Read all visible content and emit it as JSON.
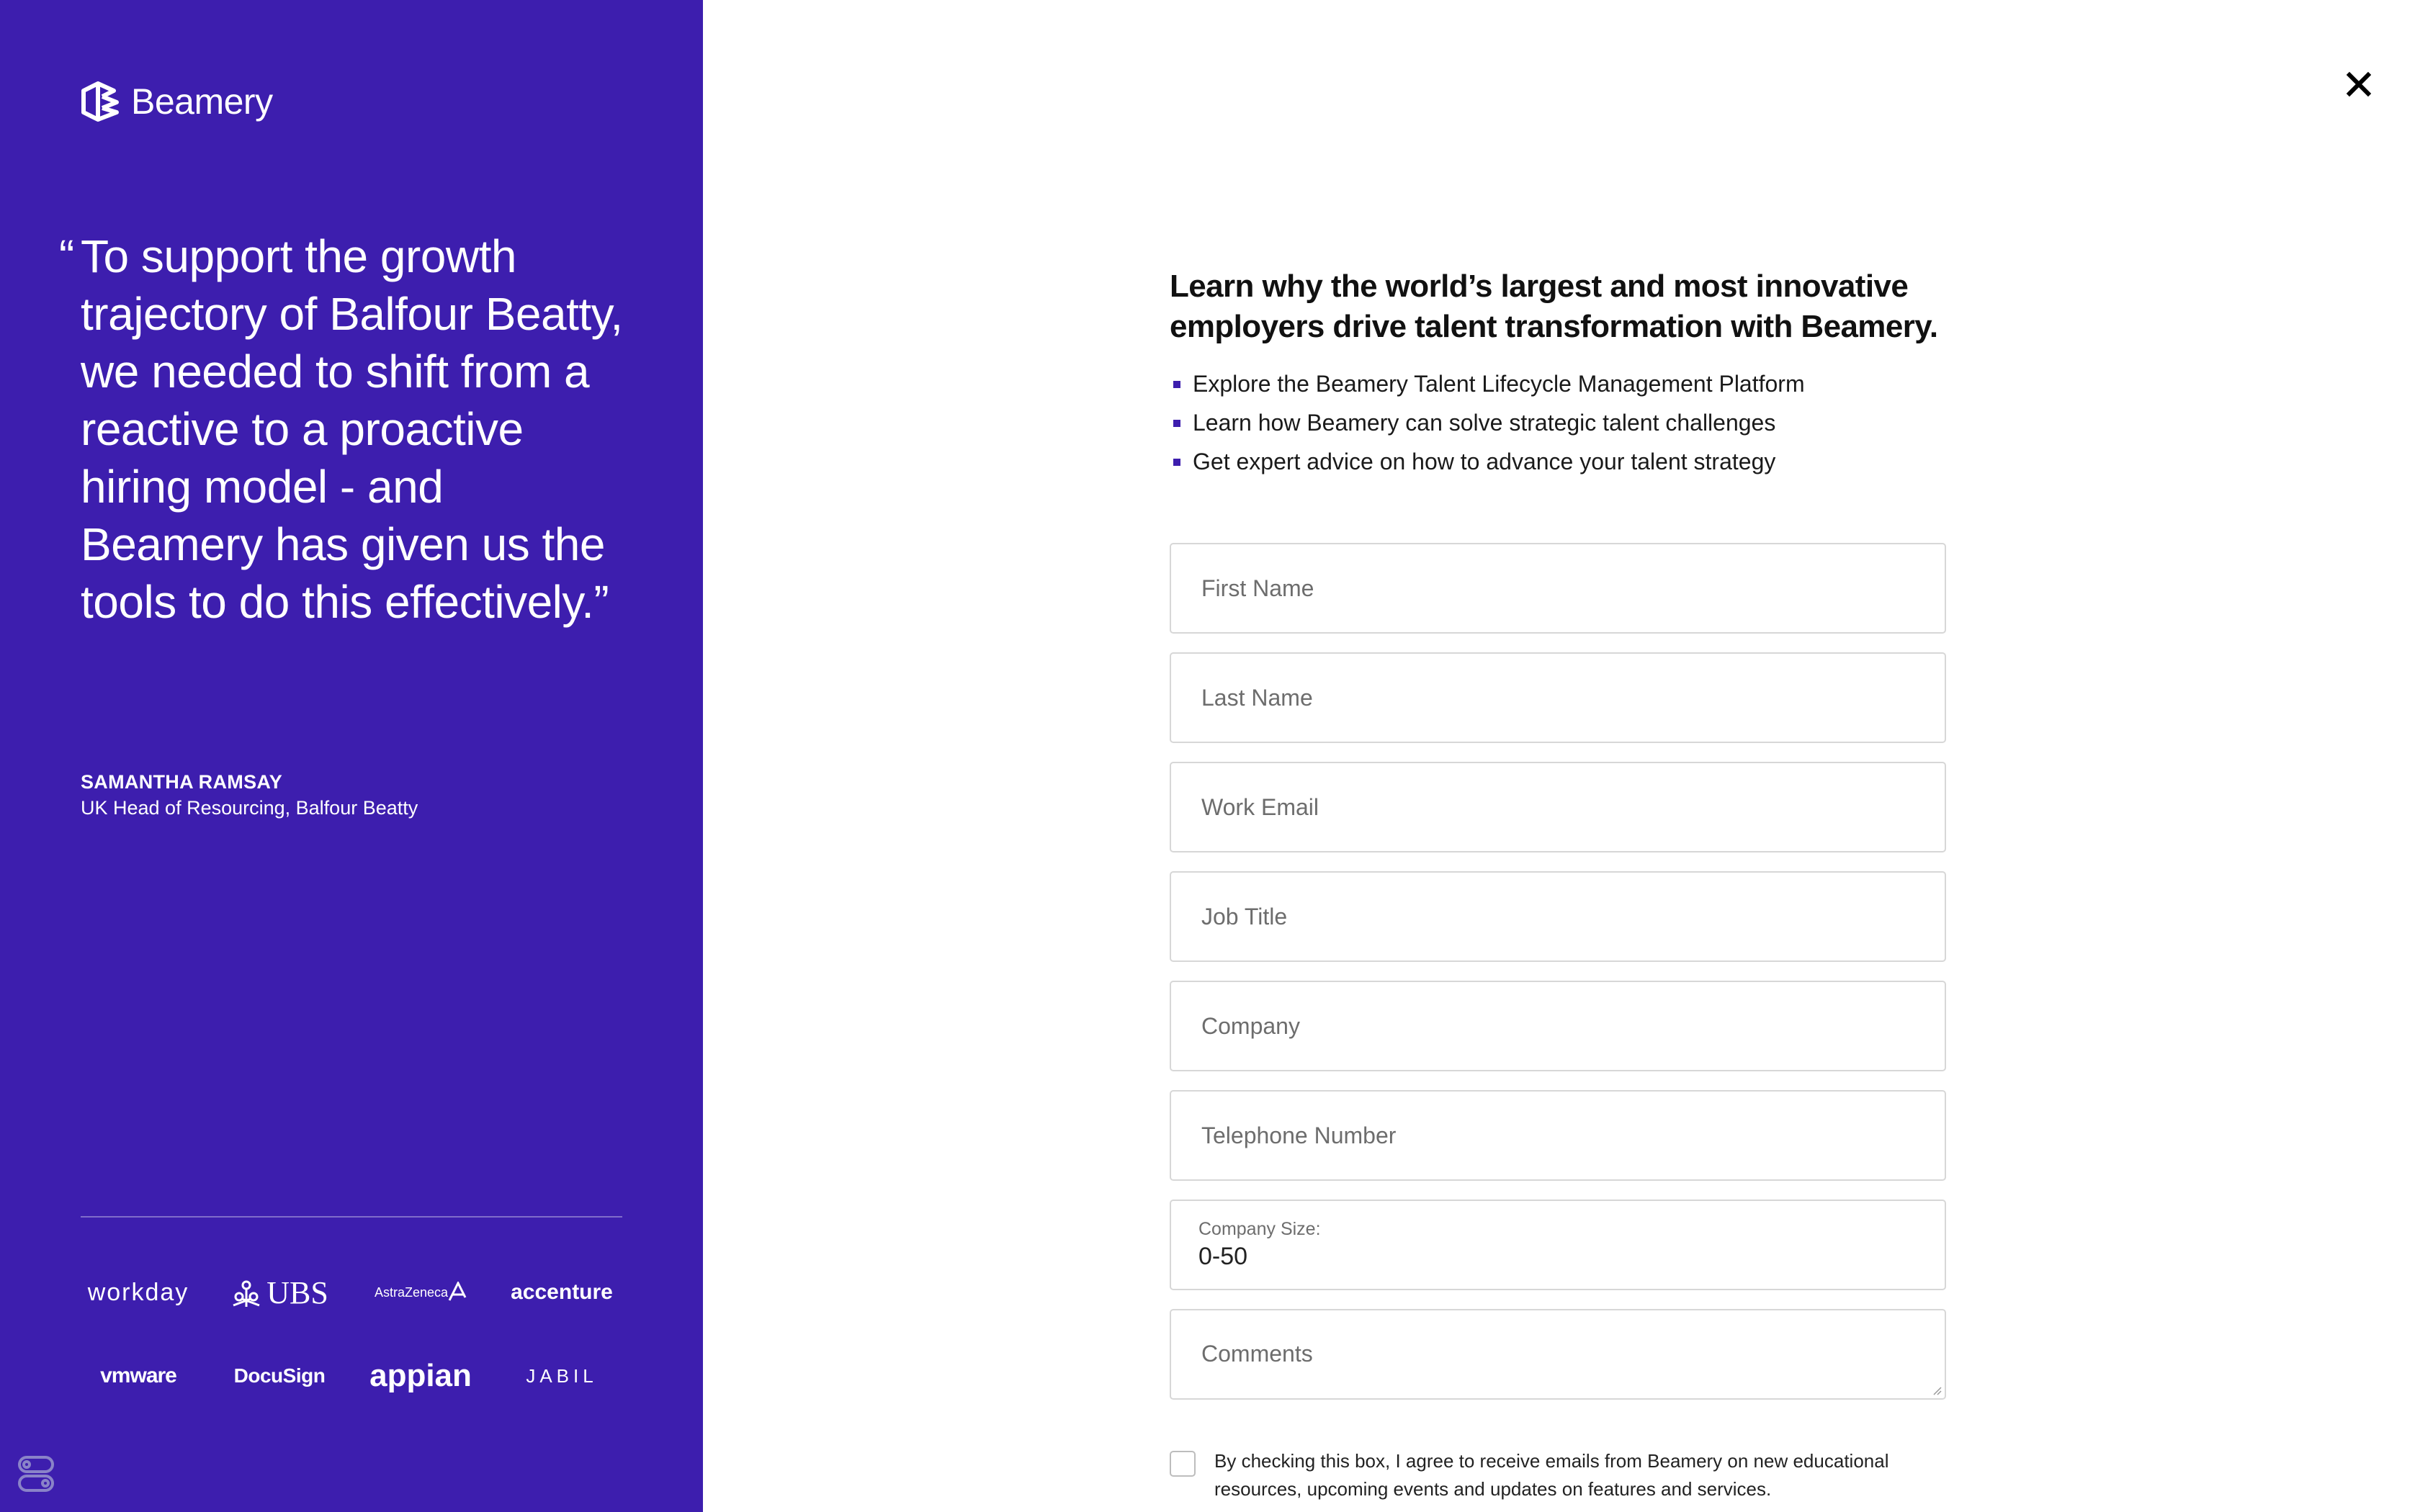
{
  "brand": {
    "name": "Beamery"
  },
  "testimonial": {
    "quote": "To support the growth trajectory of Balfour Beatty, we needed to shift from a reactive to a proactive hiring model - and Beamery has given us the tools to do this effectively.”",
    "open_quote": "“",
    "author": "SAMANTHA RAMSAY",
    "role": "UK Head of Resourcing, Balfour Beatty"
  },
  "customer_logos": [
    "workday",
    "UBS",
    "AstraZeneca",
    "accenture",
    "vmware",
    "DocuSign",
    "appian",
    "JABIL"
  ],
  "form": {
    "heading": "Learn why the world’s largest and most innovative employers drive talent transformation with Beamery.",
    "bullets": [
      "Explore the Beamery Talent Lifecycle Management Platform",
      "Learn how Beamery can solve strategic talent challenges",
      "Get expert advice on how to advance your talent strategy"
    ],
    "first_name_placeholder": "First Name",
    "last_name_placeholder": "Last Name",
    "work_email_placeholder": "Work Email",
    "job_title_placeholder": "Job Title",
    "company_placeholder": "Company",
    "telephone_placeholder": "Telephone Number",
    "company_size_label": "Company Size:",
    "company_size_value": "0-50",
    "comments_placeholder": "Comments",
    "consent_text": "By checking this box, I agree to receive emails from Beamery on new educational resources, upcoming events and updates on features and services."
  },
  "colors": {
    "accent": "#3d1eae",
    "field_border": "#d7d7d7"
  },
  "icons": {
    "close": "close-icon",
    "brand": "beamery-logo-icon",
    "widget": "settings-widget-icon"
  }
}
